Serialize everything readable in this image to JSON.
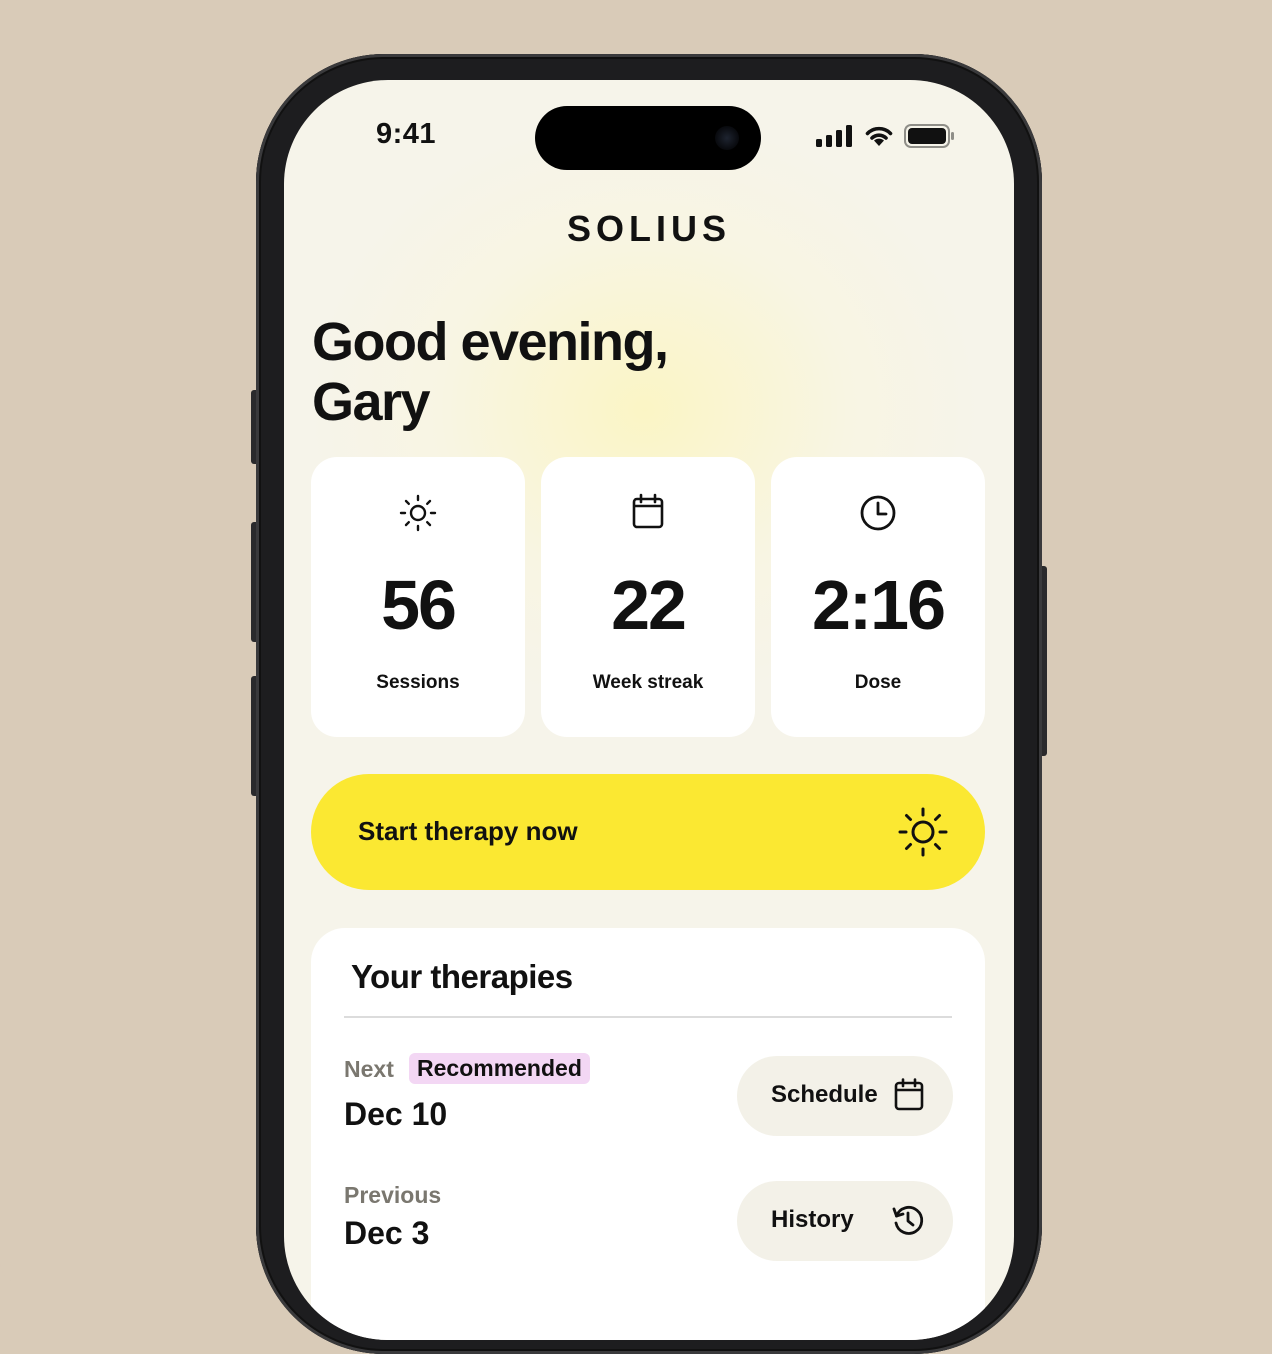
{
  "status": {
    "time": "9:41"
  },
  "brand": {
    "logo": "SOLIUS"
  },
  "greeting": {
    "line1": "Good evening,",
    "line2": "Gary"
  },
  "stats": [
    {
      "icon": "sun-icon",
      "value": "56",
      "label": "Sessions"
    },
    {
      "icon": "calendar-icon",
      "value": "22",
      "label": "Week streak"
    },
    {
      "icon": "clock-icon",
      "value": "2:16",
      "label": "Dose"
    }
  ],
  "cta": {
    "label": "Start therapy now",
    "icon": "sun-icon"
  },
  "therapies": {
    "title": "Your therapies",
    "next": {
      "label": "Next",
      "badge": "Recommended",
      "date": "Dec 10",
      "action": "Schedule",
      "action_icon": "calendar-icon"
    },
    "previous": {
      "label": "Previous",
      "date": "Dec 3",
      "action": "History",
      "action_icon": "history-icon"
    }
  },
  "colors": {
    "accent": "#fbe832",
    "badge": "#f3d7f4",
    "background": "#d9cbb8"
  }
}
